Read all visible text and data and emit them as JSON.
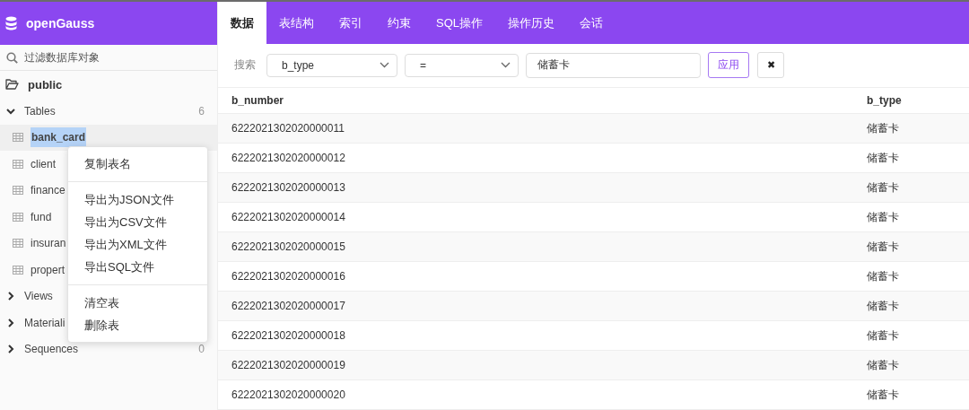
{
  "app": {
    "title": "openGauss"
  },
  "sidebar": {
    "filter": {
      "placeholder": "过滤数据库对象"
    },
    "schema": "public",
    "groups": [
      {
        "label": "Tables",
        "count": "6",
        "expanded": true,
        "children": [
          {
            "label": "bank_card",
            "selected": true
          },
          {
            "label": "client",
            "selected": false
          },
          {
            "label": "finance",
            "selected": false
          },
          {
            "label": "fund",
            "selected": false
          },
          {
            "label": "insuran",
            "selected": false
          },
          {
            "label": "propert",
            "selected": false
          }
        ]
      },
      {
        "label": "Views",
        "expanded": false
      },
      {
        "label": "Materiali",
        "expanded": false
      },
      {
        "label": "Sequences",
        "count": "0",
        "expanded": false
      }
    ]
  },
  "context_menu": {
    "sections": [
      [
        "复制表名"
      ],
      [
        "导出为JSON文件",
        "导出为CSV文件",
        "导出为XML文件",
        "导出SQL文件"
      ],
      [
        "清空表",
        "删除表"
      ]
    ]
  },
  "tabs": [
    {
      "label": "数据",
      "selected": true
    },
    {
      "label": "表结构",
      "selected": false
    },
    {
      "label": "索引",
      "selected": false
    },
    {
      "label": "约束",
      "selected": false
    },
    {
      "label": "SQL操作",
      "selected": false
    },
    {
      "label": "操作历史",
      "selected": false
    },
    {
      "label": "会话",
      "selected": false
    }
  ],
  "search": {
    "label": "搜索",
    "column": "b_type",
    "operator": "=",
    "value": "储蓄卡",
    "apply": "应用",
    "clear": "✖"
  },
  "table": {
    "columns": [
      "b_number",
      "b_type"
    ],
    "rows": [
      [
        "6222021302020000011",
        "储蓄卡"
      ],
      [
        "6222021302020000012",
        "储蓄卡"
      ],
      [
        "6222021302020000013",
        "储蓄卡"
      ],
      [
        "6222021302020000014",
        "储蓄卡"
      ],
      [
        "6222021302020000015",
        "储蓄卡"
      ],
      [
        "6222021302020000016",
        "储蓄卡"
      ],
      [
        "6222021302020000017",
        "储蓄卡"
      ],
      [
        "6222021302020000018",
        "储蓄卡"
      ],
      [
        "6222021302020000019",
        "储蓄卡"
      ],
      [
        "6222021302020000020",
        "储蓄卡"
      ]
    ]
  }
}
